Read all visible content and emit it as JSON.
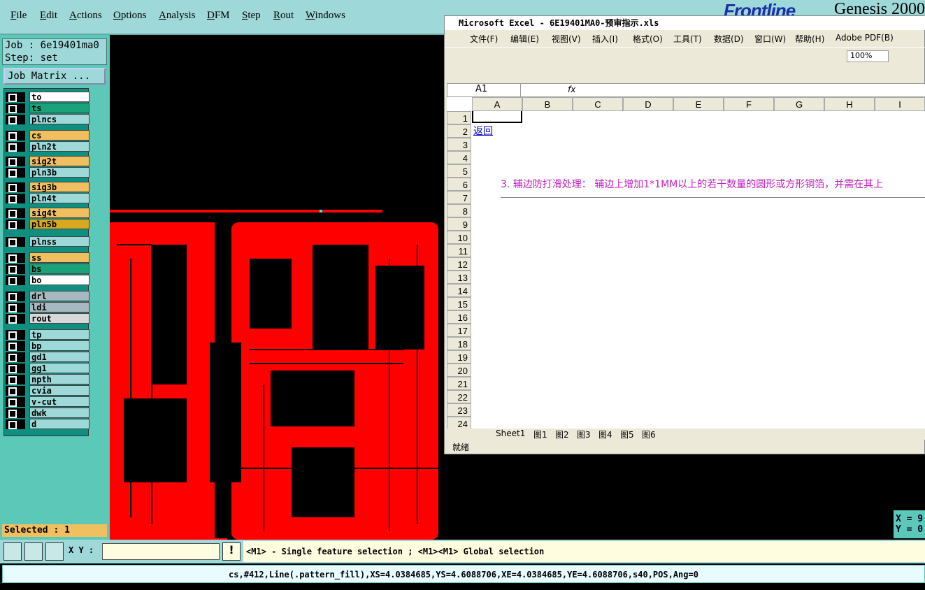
{
  "menu": [
    "File",
    "Edit",
    "Actions",
    "Options",
    "Analysis",
    "DFM",
    "Step",
    "Rout",
    "Windows"
  ],
  "brand": {
    "frontline": "Frontline",
    "genesis": "Genesis 2000"
  },
  "job": {
    "job_label": "Job : 6e19401ma0",
    "step_label": "Step: set",
    "matrix_button": "Job Matrix ..."
  },
  "layers": [
    {
      "name": "to",
      "color": "#ffffff"
    },
    {
      "name": "ts",
      "color": "#1aa37a"
    },
    {
      "name": "plncs",
      "color": "#9ed8d8"
    },
    {
      "name": "cs",
      "color": "#f0c060"
    },
    {
      "name": "pln2t",
      "color": "#9ed8d8"
    },
    {
      "name": "sig2t",
      "color": "#f0c060"
    },
    {
      "name": "pln3b",
      "color": "#9ed8d8"
    },
    {
      "name": "sig3b",
      "color": "#f0c060"
    },
    {
      "name": "pln4t",
      "color": "#9ed8d8"
    },
    {
      "name": "sig4t",
      "color": "#f0c060"
    },
    {
      "name": "pln5b",
      "color": "#d8a820"
    },
    {
      "name": "plnss",
      "color": "#9ed8d8"
    },
    {
      "name": "ss",
      "color": "#f0c060"
    },
    {
      "name": "bs",
      "color": "#1aa37a"
    },
    {
      "name": "bo",
      "color": "#ffffff"
    },
    {
      "name": "drl",
      "color": "#a8b8c0"
    },
    {
      "name": "ldi",
      "color": "#a8b8c0"
    },
    {
      "name": "rout",
      "color": "#d8d8d8"
    },
    {
      "name": "tp",
      "color": "#9ed8d8"
    },
    {
      "name": "bp",
      "color": "#9ed8d8"
    },
    {
      "name": "gd1",
      "color": "#9ed8d8"
    },
    {
      "name": "gg1",
      "color": "#9ed8d8"
    },
    {
      "name": "npth",
      "color": "#9ed8d8"
    },
    {
      "name": "cvia",
      "color": "#9ed8d8"
    },
    {
      "name": "v-cut",
      "color": "#9ed8d8"
    },
    {
      "name": "dwk",
      "color": "#9ed8d8"
    },
    {
      "name": "d",
      "color": "#9ed8d8"
    }
  ],
  "selected_text": "Selected : 1",
  "excel": {
    "title": "Microsoft Excel - 6E19401MA0-预审指示.xls",
    "menu": [
      "文件(F)",
      "编辑(E)",
      "视图(V)",
      "插入(I)",
      "格式(O)",
      "工具(T)",
      "数据(D)",
      "窗口(W)",
      "帮助(H)",
      "Adobe PDF(B)"
    ],
    "zoom": "100%",
    "name_box": "A1",
    "fx": "fx",
    "columns": [
      "A",
      "B",
      "C",
      "D",
      "E",
      "F",
      "G",
      "H",
      "I"
    ],
    "rows": [
      "1",
      "2",
      "3",
      "4",
      "5",
      "6",
      "7",
      "8",
      "9",
      "10",
      "11",
      "12",
      "13",
      "14",
      "15",
      "16",
      "17",
      "18",
      "19",
      "20",
      "21",
      "22",
      "23",
      "24"
    ],
    "cell_a2": "返回",
    "cell_text": "3. 辅边防打滑处理： 辅边上增加1*1MM以上的若干数量的圆形或方形铜箔，并需在其上",
    "sheets": [
      "Sheet1",
      "图1",
      "图2",
      "图3",
      "图4",
      "图5",
      "图6"
    ],
    "status": "就绪"
  },
  "xy_label": "X Y :",
  "message": "<M1> - Single feature selection ; <M1><M1> Global selection",
  "status_line": "cs,#412,Line(.pattern_fill),XS=4.0384685,YS=4.6088706,XE=4.0384685,YE=4.6088706,s40,POS,Ang=0",
  "coord": {
    "x": "X = 9",
    "y": "Y = 0"
  }
}
